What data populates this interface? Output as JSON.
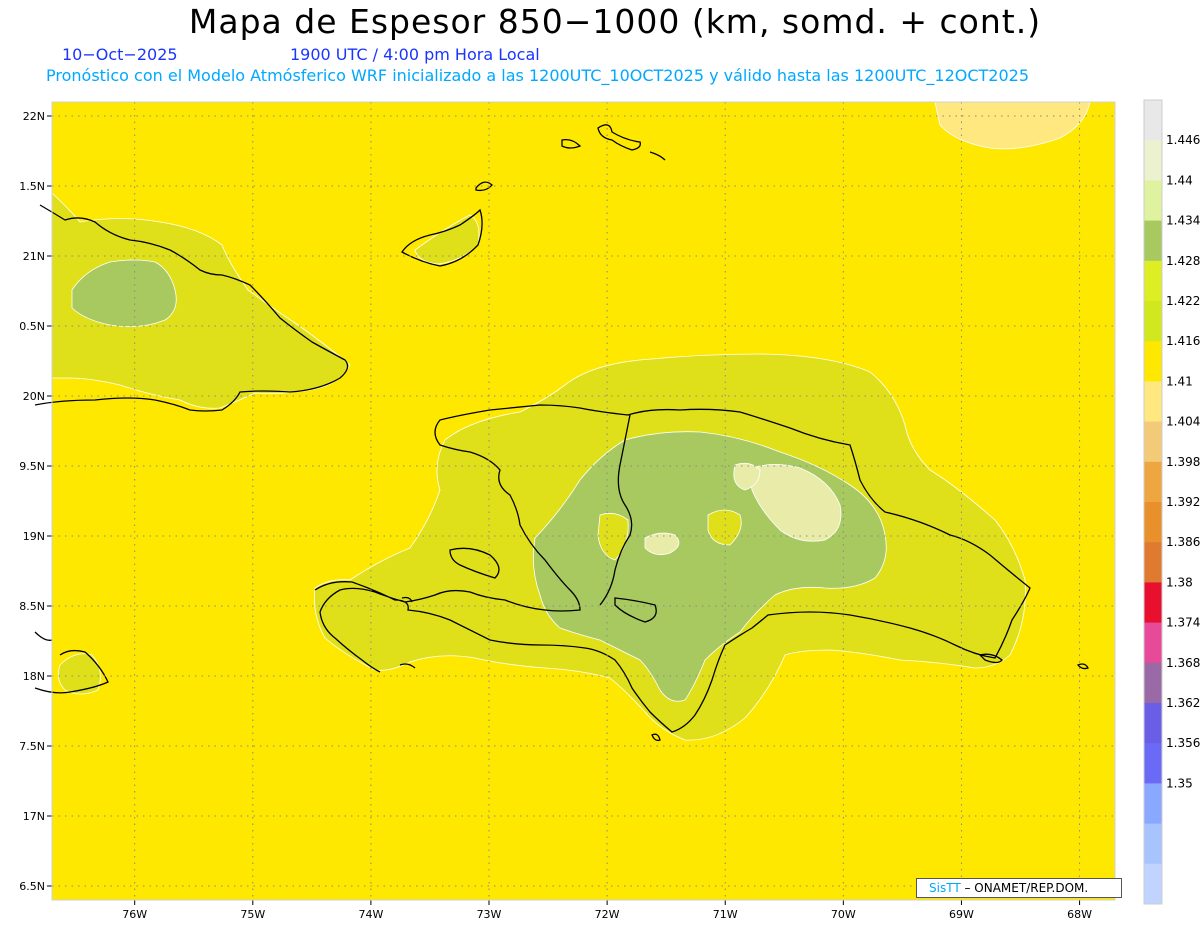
{
  "header": {
    "title": "Mapa de Espesor 850−1000 (km, somd. + cont.)",
    "date": "10−Oct−2025",
    "time": "1900 UTC / 4:00 pm Hora Local",
    "forecast": "Pronóstico con el Modelo Atmósferico WRF inicializado a las 1200UTC_10OCT2025 y válido hasta las  1200UTC_12OCT2025"
  },
  "map": {
    "lon_range": [
      -76.7,
      -67.7
    ],
    "lat_range": [
      16.4,
      22.1
    ],
    "lon_ticks": [
      "76W",
      "75W",
      "74W",
      "73W",
      "72W",
      "71W",
      "70W",
      "69W",
      "68W"
    ],
    "lat_ticks": [
      "22N",
      "1.5N",
      "21N",
      "0.5N",
      "20N",
      "9.5N",
      "19N",
      "8.5N",
      "18N",
      "7.5N",
      "17N",
      "6.5N"
    ],
    "background_color": "#ffe800",
    "fill_colors": {
      "band_1416_1422": "#e0e01a",
      "band_1422_1428": "#a8c860",
      "band_1428_1434": "#e8eca8",
      "band_1410_1416": "#ffe880",
      "coast": "#000000"
    }
  },
  "colorbar": {
    "labels": [
      "1.446",
      "1.44",
      "1.434",
      "1.428",
      "1.422",
      "1.416",
      "1.41",
      "1.404",
      "1.398",
      "1.392",
      "1.386",
      "1.38",
      "1.374",
      "1.368",
      "1.362",
      "1.356",
      "1.35"
    ],
    "colors": [
      "#e8e8e8",
      "#ecf2d0",
      "#dff2a0",
      "#a8c860",
      "#ddee22",
      "#d2e81e",
      "#ffe800",
      "#ffe880",
      "#f3ca78",
      "#eda640",
      "#e8902c",
      "#e07a30",
      "#e8102e",
      "#e84a9a",
      "#9a6aa6",
      "#6a5ee6",
      "#6a6af6",
      "#8aa8ff",
      "#a8c4ff",
      "#c0d4ff"
    ]
  },
  "credit": {
    "brand": "SisTT",
    "org": "– ONAMET/REP.DOM."
  }
}
